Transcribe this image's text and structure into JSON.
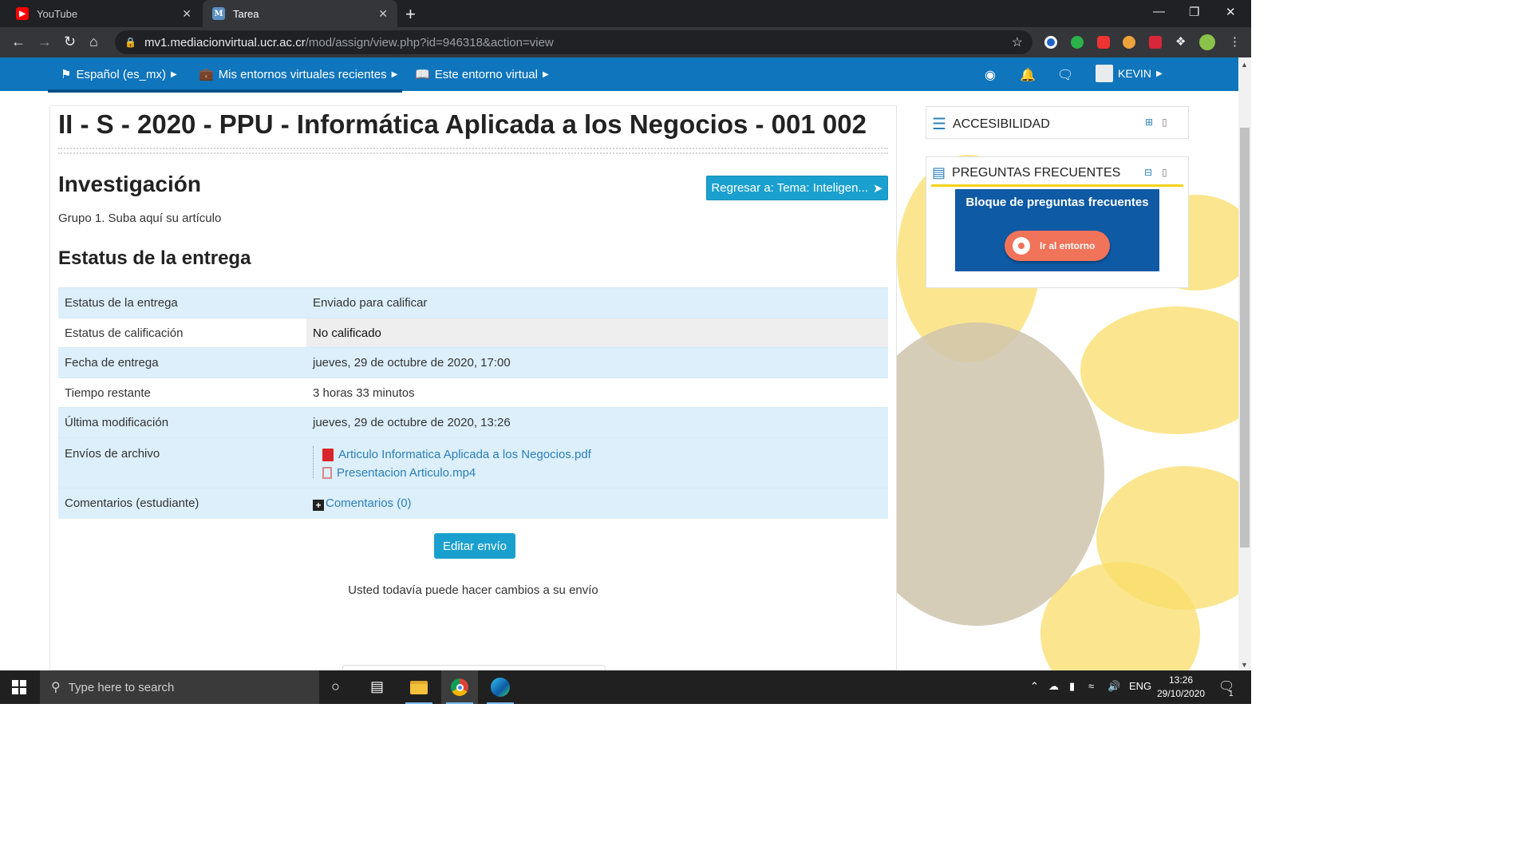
{
  "browser": {
    "tabs": [
      {
        "title": "YouTube",
        "favicon": "youtube-icon",
        "active": false
      },
      {
        "title": "Tarea",
        "favicon": "moodle-m-icon",
        "active": true
      }
    ],
    "url_host": "mv1.mediacionvirtual.ucr.ac.cr",
    "url_path": "/mod/assign/view.php?id=946318&action=view"
  },
  "navbar": {
    "language": "Español (es_mx)",
    "recent": "Mis entornos virtuales recientes",
    "this_course": "Este entorno virtual",
    "user": "KEVIN"
  },
  "main": {
    "course_title": "II - S - 2020 - PPU - Informática Aplicada a los Negocios - 001 002",
    "activity_title": "Investigación",
    "back_button": "Regresar a: Tema: Inteligen...",
    "intro": "Grupo 1. Suba aquí su artículo",
    "section_title": "Estatus de la entrega",
    "status_rows": [
      {
        "label": "Estatus de la entrega",
        "value": "Enviado para calificar"
      },
      {
        "label": "Estatus de calificación",
        "value": "No calificado"
      },
      {
        "label": "Fecha de entrega",
        "value": "jueves, 29 de octubre de 2020, 17:00"
      },
      {
        "label": "Tiempo restante",
        "value": "3 horas 33 minutos"
      },
      {
        "label": "Última modificación",
        "value": "jueves, 29 de octubre de 2020, 13:26"
      },
      {
        "label": "Envíos de archivo",
        "files": [
          "Articulo Informatica Aplicada a los Negocios.pdf",
          "Presentacion Articulo.mp4"
        ]
      },
      {
        "label": "Comentarios (estudiante)",
        "value": "Comentarios (0)"
      }
    ],
    "edit_button": "Editar envío",
    "note": "Usted todavía puede hacer cambios a su envío"
  },
  "sidebar": {
    "accessibility": "ACCESIBILIDAD",
    "faq": "PREGUNTAS FRECUENTES",
    "faq_banner_text": "Bloque de preguntas frecuentes",
    "faq_banner_button": "Ir al entorno"
  },
  "taskbar": {
    "search_placeholder": "Type here to search",
    "language": "ENG",
    "time": "13:26",
    "date": "29/10/2020",
    "notification_count": "1"
  },
  "colors": {
    "navbar": "#0f75bc",
    "button": "#1aa0cf",
    "table_row": "#dceffb",
    "link": "#2c7fb8"
  }
}
